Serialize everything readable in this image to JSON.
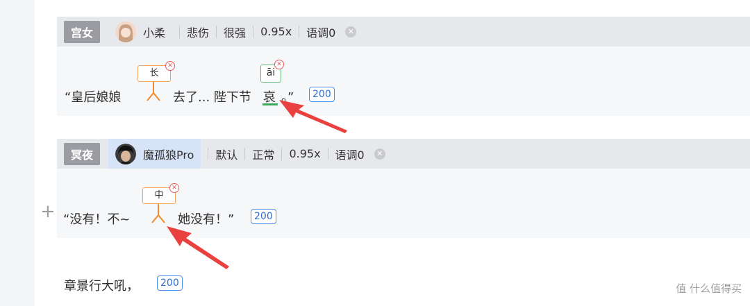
{
  "blocks": [
    {
      "role": "宫女",
      "voice": "小柔",
      "emotion": "悲伤",
      "strength": "很强",
      "speed": "0.95x",
      "tone": "语调0",
      "text": {
        "open": "“皇后娘娘",
        "mid": "去了... 陛下节",
        "char": "哀",
        "close": "。”"
      },
      "pause_label": "长",
      "pinyin": "āi",
      "count": "200"
    },
    {
      "role": "冥夜",
      "voice": "魔孤狼Pro",
      "emotion": "默认",
      "strength": "正常",
      "speed": "0.95x",
      "tone": "语调0",
      "text": {
        "open": "“没有！不~",
        "mid": "她没有！”"
      },
      "pause_label": "中",
      "count": "200"
    }
  ],
  "plain_line": {
    "text": "章景行大吼，",
    "count": "200"
  },
  "icons": {
    "close": "close-circle-icon",
    "plus": "plus-icon",
    "pause": "pause-marker-icon",
    "arrow": "red-arrow-icon"
  },
  "colors": {
    "accent_blue": "#4a8fe7",
    "pause_orange": "#f08a2c",
    "pinyin_green": "#3ea55a",
    "arrow_red": "#e8413f"
  },
  "watermark": "值 什么值得买"
}
